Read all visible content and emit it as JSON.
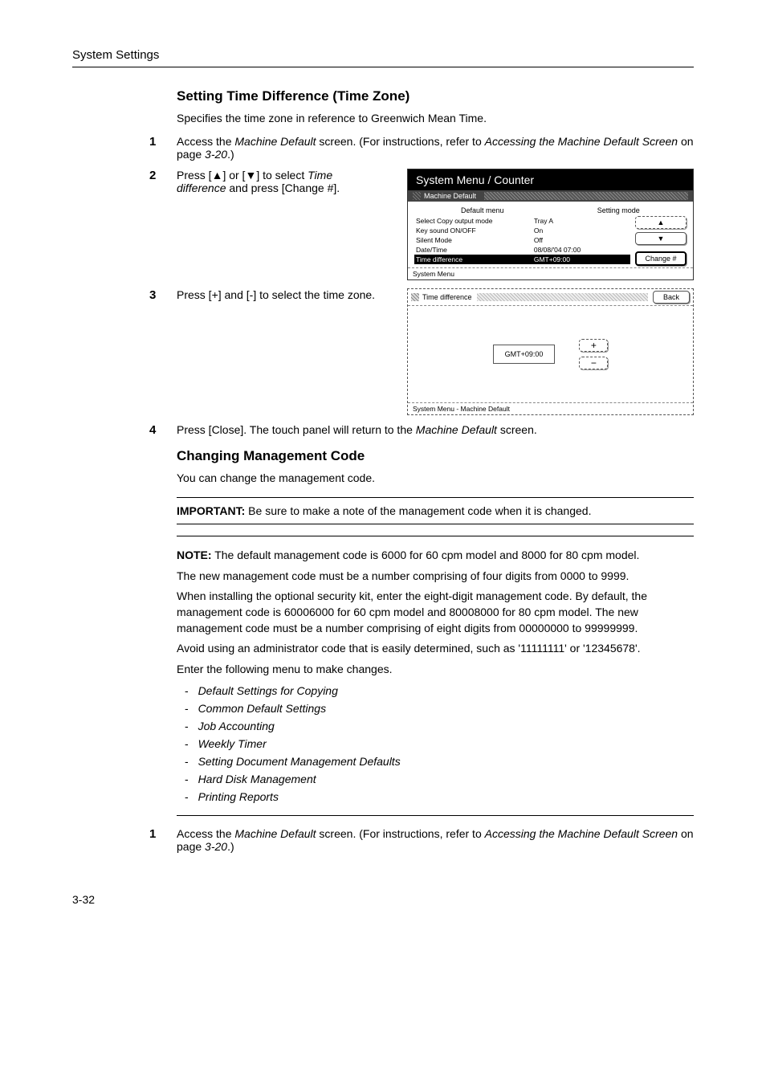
{
  "page_header": "System Settings",
  "section1_title": "Setting Time Difference (Time Zone)",
  "section1_intro": "Specifies the time zone in reference to Greenwich Mean Time.",
  "step1_num": "1",
  "step1_a": "Access the ",
  "step1_b_em": "Machine Default",
  "step1_c": " screen. (For instructions, refer to ",
  "step1_d_em": "Accessing the Machine Default Screen",
  "step1_e": " on page ",
  "step1_f_em": "3-20",
  "step1_g": ".)",
  "step2_num": "2",
  "step2_a": "Press [",
  "step2_tri_up": "▲",
  "step2_b": "] or [",
  "step2_tri_down": "▼",
  "step2_c": "] to select ",
  "step2_d_em": "Time difference",
  "step2_e": " and press [Change #].",
  "panel1": {
    "title": "System Menu / Counter",
    "subtitle": "Machine Default",
    "col1": "Default menu",
    "col2": "Setting mode",
    "rows": [
      {
        "l": "Select Copy output mode",
        "r": "Tray A"
      },
      {
        "l": "Key sound ON/OFF",
        "r": "On"
      },
      {
        "l": "Silent Mode",
        "r": "Off"
      },
      {
        "l": "Date/Time",
        "r": "08/08/'04 07:00"
      },
      {
        "l": "Time difference",
        "r": "GMT+09:00"
      }
    ],
    "btn_change": "Change #",
    "breadcrumb": "System Menu"
  },
  "step3_num": "3",
  "step3_text": "Press [+] and [-] to select the time zone.",
  "panel2": {
    "title": "Time difference",
    "back": "Back",
    "value": "GMT+09:00",
    "plus": "+",
    "minus": "−",
    "breadcrumb": "System Menu     -   Machine Default"
  },
  "step4_num": "4",
  "step4_a": "Press [Close]. The touch panel will return to the ",
  "step4_b_em": "Machine Default",
  "step4_c": " screen.",
  "section2_title": "Changing Management Code",
  "section2_intro": "You can change the management code.",
  "important_label": "IMPORTANT:",
  "important_text": " Be sure to make a note of the management code when it is changed.",
  "note_label": "NOTE:",
  "note_text": " The default management code is 6000 for 60 cpm model and 8000 for 80 cpm model.",
  "note_p2": "The new management code must be a number comprising of four digits from 0000 to 9999.",
  "note_p3": "When installing the optional security kit, enter the eight-digit management code. By default, the management code is 60006000 for 60 cpm model and 80008000 for 80 cpm model. The new management code must be a number comprising of eight digits from 00000000 to 99999999.",
  "note_p4": "Avoid using an administrator code that is easily determined, such as '11111111' or '12345678'.",
  "note_p5": "Enter the following menu to make changes.",
  "menu_items": [
    "Default Settings for Copying",
    "Common Default Settings",
    "Job Accounting",
    "Weekly Timer",
    "Setting Document Management Defaults",
    "Hard Disk Management",
    "Printing Reports"
  ],
  "s2_step1_num": "1",
  "page_number": "3-32"
}
